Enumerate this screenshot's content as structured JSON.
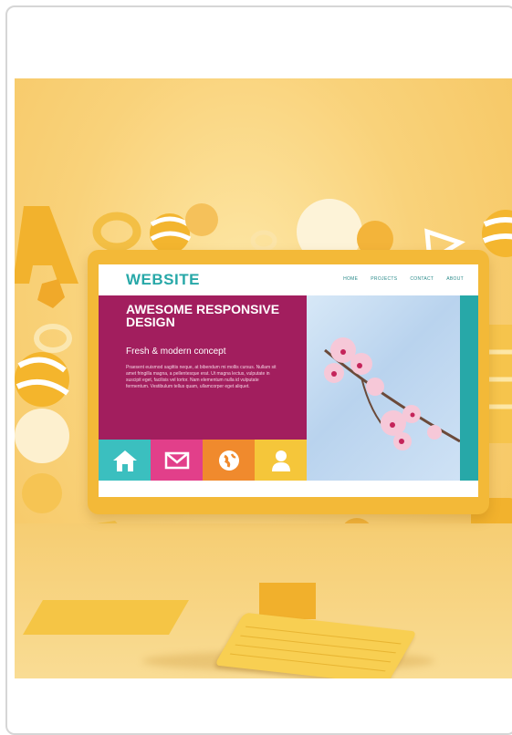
{
  "image": {
    "alt_subject": "3D yellow computer monitor showing a responsive website surrounded by floating shapes"
  },
  "website": {
    "title": "WEBSITE",
    "nav": [
      "HOME",
      "PROJECTS",
      "CONTACT",
      "ABOUT"
    ],
    "hero_title": "AWESOME RESPONSIVE DESIGN",
    "hero_subtitle": "Fresh & modern concept",
    "hero_body": "Praesent euismod sagittis neque, at bibendum mi mollis cursus. Nullam sit amet fringilla magna, a pellentesque erat. Ut magna lectus, vulputate in suscipit eget, facilisis vel tortor. Nam elementum nulla id vulputate fermentum. Vestibulum tellus quam, ullamcorper eget aliquet.",
    "tiles": [
      "home-icon",
      "mail-icon",
      "globe-icon",
      "user-icon"
    ]
  },
  "colors": {
    "background": "#f9d27a",
    "monitor": "#f3b938",
    "teal": "#27a8a8",
    "magenta": "#a21e5e",
    "pink": "#e23f8a",
    "orange": "#f08a2d"
  }
}
